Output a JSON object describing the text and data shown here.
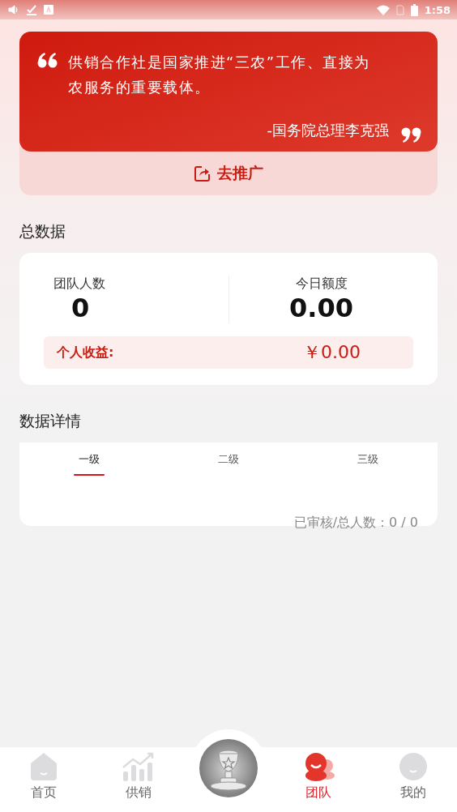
{
  "status_bar": {
    "time": "1:58"
  },
  "quote": {
    "text": "供销合作社是国家推进“三农”工作、直接为农服务的重要载体。",
    "author": "-国务院总理李克强"
  },
  "promote_button": {
    "label": "去推广"
  },
  "summary": {
    "title": "总数据",
    "stats": [
      {
        "label": "团队人数",
        "value": "0"
      },
      {
        "label": "今日额度",
        "value": "0.00"
      }
    ],
    "income": {
      "label": "个人收益:",
      "value": "￥0.00"
    }
  },
  "details": {
    "title": "数据详情",
    "tabs": [
      {
        "label": "一级",
        "selected": true
      },
      {
        "label": "二级",
        "selected": false
      },
      {
        "label": "三级",
        "selected": false
      }
    ],
    "footer": "已审核/总人数：0 / 0"
  },
  "nav": [
    {
      "kind": "home",
      "label": "首页",
      "selected": false
    },
    {
      "kind": "chart",
      "label": "供销",
      "selected": false
    },
    {
      "kind": "trophy",
      "selected": false
    },
    {
      "kind": "team",
      "label": "团队",
      "selected": true
    },
    {
      "kind": "me",
      "label": "我的",
      "selected": false
    }
  ]
}
